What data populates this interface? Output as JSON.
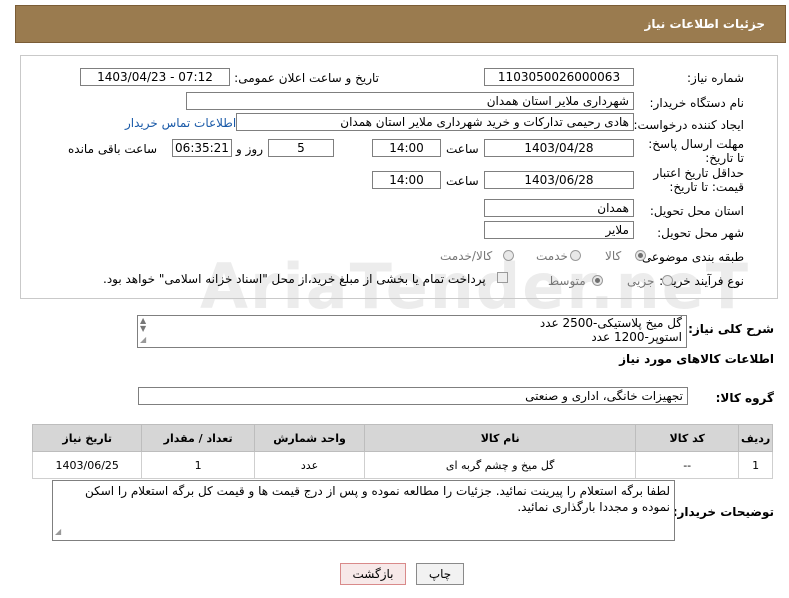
{
  "header": {
    "title": "جزئیات اطلاعات نیاز"
  },
  "form": {
    "need_number_label": "شماره نیاز:",
    "need_number": "1103050026000063",
    "announce_label": "تاریخ و ساعت اعلان عمومی:",
    "announce_value": "1403/04/23 - 07:12",
    "buyer_org_label": "نام دستگاه خریدار:",
    "buyer_org": "شهرداری ملایر استان همدان",
    "creator_label": "ایجاد کننده درخواست:",
    "creator": "هادی رحیمی تدارکات و خرید شهرداری ملایر استان همدان",
    "contact_link": "اطلاعات تماس خریدار",
    "deadline_label": "مهلت ارسال پاسخ: تا تاریخ:",
    "deadline_date": "1403/04/28",
    "time_label": "ساعت",
    "deadline_time": "14:00",
    "days_value": "5",
    "days_label": "روز و",
    "remaining_time": "06:35:21",
    "remaining_label": "ساعت باقی مانده",
    "validity_label": "حداقل تاریخ اعتبار قیمت: تا تاریخ:",
    "validity_date": "1403/06/28",
    "validity_time": "14:00",
    "province_label": "استان محل تحویل:",
    "province": "همدان",
    "city_label": "شهر محل تحویل:",
    "city": "ملایر",
    "category_label": "طبقه بندی موضوعی:",
    "category_options": [
      "کالا",
      "خدمت",
      "کالا/خدمت"
    ],
    "process_label": "نوع فرآیند خرید :",
    "process_options": [
      "جزیی",
      "متوسط"
    ],
    "payment_note": "پرداخت تمام یا بخشی از مبلغ خرید،از محل \"اسناد خزانه اسلامی\" خواهد بود."
  },
  "description": {
    "label": "شرح کلی نیاز:",
    "text_line1": "گل میخ پلاستیکی-2500 عدد",
    "text_line2": "استوپر-1200 عدد"
  },
  "goods": {
    "section_title": "اطلاعات کالاهای مورد نیاز",
    "group_label": "گروه کالا:",
    "group_value": "تجهیزات خانگی، اداری و صنعتی"
  },
  "table": {
    "headers": [
      "ردیف",
      "کد کالا",
      "نام کالا",
      "واحد شمارش",
      "تعداد / مقدار",
      "تاریخ نیاز"
    ],
    "rows": [
      [
        "1",
        "--",
        "گل میخ و چشم گربه ای",
        "عدد",
        "1",
        "1403/06/25"
      ]
    ]
  },
  "buyer_notes": {
    "label": "توضیحات خریدار:",
    "text": "لطفا برگه استعلام را پیرینت نمائید. جزئیات را مطالعه نموده و پس از درج قیمت ها و قیمت کل برگه استعلام را اسکن نموده و مجددا بارگذاری نمائید."
  },
  "buttons": {
    "print": "چاپ",
    "back": "بازگشت"
  },
  "watermark": "AriaTender.neT",
  "colors": {
    "header_bg": "#9a7b4f",
    "link": "#1a5aa8",
    "back_button_border": "#d98a8a"
  }
}
